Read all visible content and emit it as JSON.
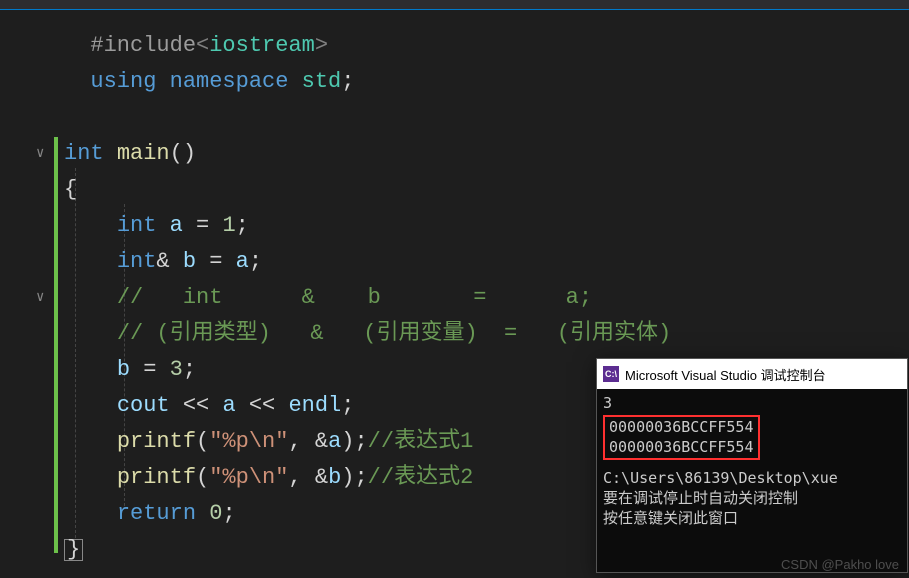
{
  "code": {
    "l1": {
      "pp": "#include",
      "ang1": "<",
      "lib": "iostream",
      "ang2": ">"
    },
    "l2": {
      "kw1": "using",
      "kw2": "namespace",
      "ns": "std",
      "semi": ";"
    },
    "l4": {
      "type": "int",
      "fn": "main",
      "paren": "()"
    },
    "l5": {
      "brace": "{"
    },
    "l6": {
      "type": "int",
      "id": "a",
      "op": " = ",
      "num": "1",
      "semi": ";"
    },
    "l7": {
      "type": "int",
      "amp": "&",
      "id": "b",
      "op": " = ",
      "rhs": "a",
      "semi": ";"
    },
    "l8": {
      "cmt": "//   int      &    b       =      a;"
    },
    "l9": {
      "cmt": "// (引用类型)   &   (引用变量)  =   (引用实体)"
    },
    "l10": {
      "id": "b",
      "op": " = ",
      "num": "3",
      "semi": ";"
    },
    "l11": {
      "obj": "cout",
      "op1": " << ",
      "id": "a",
      "op2": " << ",
      "endl": "endl",
      "semi": ";"
    },
    "l12": {
      "fn": "printf",
      "lp": "(",
      "str": "\"%p\\n\"",
      "comma": ", ",
      "amp": "&",
      "id": "a",
      "rp": ")",
      "semi": ";",
      "cmt": "//表达式1"
    },
    "l13": {
      "fn": "printf",
      "lp": "(",
      "str": "\"%p\\n\"",
      "comma": ", ",
      "amp": "&",
      "id": "b",
      "rp": ")",
      "semi": ";",
      "cmt": "//表达式2"
    },
    "l14": {
      "kw": "return",
      "num": "0",
      "semi": ";"
    },
    "l15": {
      "brace": "}"
    }
  },
  "console": {
    "title": "Microsoft Visual Studio 调试控制台",
    "icon_text": "C:\\",
    "out1": "3",
    "out2": "00000036BCCFF554",
    "out3": "00000036BCCFF554",
    "path": "C:\\Users\\86139\\Desktop\\xue",
    "hint1": "要在调试停止时自动关闭控制",
    "hint2": "按任意键关闭此窗口"
  },
  "watermark": "CSDN @Pakho love"
}
